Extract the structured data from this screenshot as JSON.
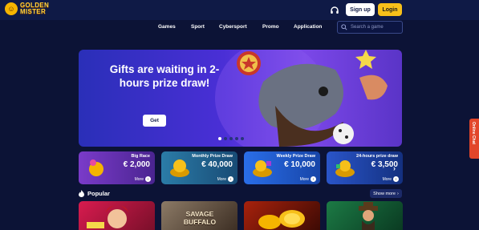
{
  "header": {
    "logo_line1": "GOLDEN",
    "logo_line2": "MISTER",
    "signup_label": "Sign up",
    "login_label": "Login"
  },
  "nav": {
    "items": [
      "Games",
      "Sport",
      "Cybersport",
      "Promo",
      "Application"
    ]
  },
  "search": {
    "placeholder": "Search a game"
  },
  "banner": {
    "title": "Gifts are waiting in 2-hours prize draw!",
    "button_label": "Get",
    "slides": 5,
    "active_slide": 1
  },
  "cards": [
    {
      "title": "Big Race",
      "amount": "€ 2,000",
      "more": "More",
      "color": "#5b2ba5"
    },
    {
      "title": "Monthly Prize Draw",
      "amount": "€ 40,000",
      "more": "More",
      "color": "#1e5e8a"
    },
    {
      "title": "Weekly Prize Draw",
      "amount": "€ 10,000",
      "more": "More",
      "color": "#1f55c9"
    },
    {
      "title": "24-hours prize draw",
      "amount": "€ 3,500",
      "more": "More",
      "color": "#173a99"
    }
  ],
  "popular": {
    "title": "Popular",
    "show_more": "Show more"
  },
  "games": [
    {
      "title": "",
      "color": "#b0123a"
    },
    {
      "title": "SAVAGE BUFFALO",
      "color": "#6c5a4c"
    },
    {
      "title": "",
      "color": "#7a1a0c"
    },
    {
      "title": "",
      "color": "#1f6b3a"
    }
  ],
  "chat": {
    "label": "Online Chat"
  },
  "icons": {
    "logo": "logo-icon",
    "support": "headset-icon",
    "search": "search-icon",
    "fire": "fire-icon",
    "arrow": "arrow-right-icon"
  },
  "colors": {
    "background": "#0c1336",
    "topbar": "#0f1a46",
    "accent": "#f7c01a",
    "chat": "#e2462a"
  }
}
